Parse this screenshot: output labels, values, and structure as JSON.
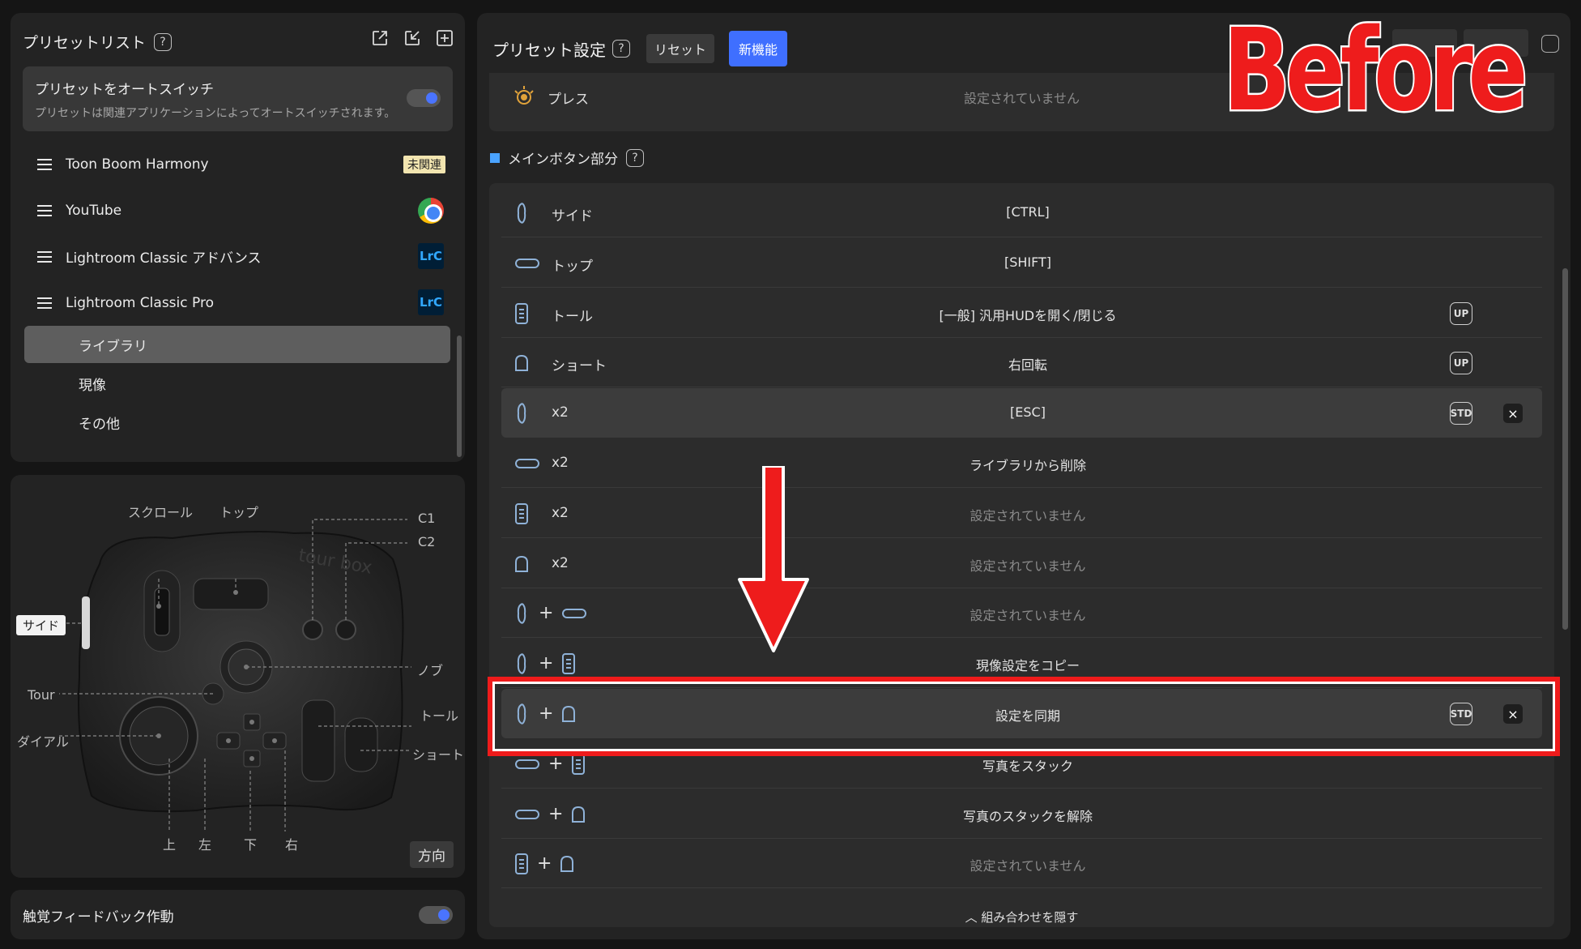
{
  "preset_panel": {
    "title": "プリセットリスト",
    "autoswitch": {
      "title": "プリセットをオートスイッチ",
      "desc": "プリセットは関連アプリケーションによってオートスイッチされます。",
      "enabled": true
    },
    "presets": [
      {
        "label": "Toon Boom Harmony",
        "badge": "未関連",
        "icon": "none"
      },
      {
        "label": "YouTube",
        "icon": "chrome-icon"
      },
      {
        "label": "Lightroom Classic アドバンス",
        "icon": "lrc-icon"
      },
      {
        "label": "Lightroom Classic Pro",
        "icon": "lrc-icon"
      }
    ],
    "lrc_text": "LrC",
    "sub_items": [
      "ライブラリ",
      "現像",
      "その他"
    ],
    "active_sub_item": "ライブラリ"
  },
  "device": {
    "labels": {
      "scroll": "スクロール",
      "top": "トップ",
      "c1": "C1",
      "c2": "C2",
      "side": "サイド",
      "knob": "ノブ",
      "tour": "Tour",
      "tall": "トール",
      "dial": "ダイアル",
      "short": "ショート",
      "up": "上",
      "left": "左",
      "down": "下",
      "right": "右",
      "brand": "tour box"
    },
    "direction_button": "方向"
  },
  "haptic": {
    "label": "触覚フィードバック作動",
    "enabled": true
  },
  "settings": {
    "title": "プリセット設定",
    "reset": "リセット",
    "new_feature": "新機能",
    "press": {
      "name": "プレス",
      "value": "設定されていません"
    },
    "section_title": "メインボタン部分",
    "rows": [
      {
        "icons": [
          "side"
        ],
        "name": "サイド",
        "value": "[CTRL]"
      },
      {
        "icons": [
          "top"
        ],
        "name": "トップ",
        "value": "[SHIFT]"
      },
      {
        "icons": [
          "tall"
        ],
        "name": "トール",
        "value": "[一般] 汎用HUDを開く/閉じる",
        "tag": "UP"
      },
      {
        "icons": [
          "short"
        ],
        "name": "ショート",
        "value": "右回転",
        "tag": "UP"
      },
      {
        "icons": [
          "side"
        ],
        "name": "x2",
        "value": "[ESC]",
        "tag": "STD",
        "closable": true,
        "highlight": true
      },
      {
        "icons": [
          "top"
        ],
        "name": "x2",
        "value": "ライブラリから削除"
      },
      {
        "icons": [
          "tall"
        ],
        "name": "x2",
        "value": "設定されていません",
        "unset": true
      },
      {
        "icons": [
          "short"
        ],
        "name": "x2",
        "value": "設定されていません",
        "unset": true
      },
      {
        "icons": [
          "side",
          "top"
        ],
        "name": "",
        "value": "設定されていません",
        "unset": true
      },
      {
        "icons": [
          "side",
          "tall"
        ],
        "name": "",
        "value": "現像設定をコピー"
      },
      {
        "icons": [
          "side",
          "short"
        ],
        "name": "",
        "value": "設定を同期",
        "tag": "STD",
        "closable": true,
        "highlight": true
      },
      {
        "icons": [
          "top",
          "tall"
        ],
        "name": "",
        "value": "写真をスタック"
      },
      {
        "icons": [
          "top",
          "short"
        ],
        "name": "",
        "value": "写真のスタックを解除"
      },
      {
        "icons": [
          "tall",
          "short"
        ],
        "name": "",
        "value": "設定されていません",
        "unset": true
      }
    ],
    "hide_combos": "組み合わせを隠す"
  },
  "overlay": {
    "before_text": "Before",
    "accent": "#ee1c1c"
  },
  "colors": {
    "accent_blue": "#3f6fff",
    "panel": "#232323",
    "background": "#151515"
  }
}
